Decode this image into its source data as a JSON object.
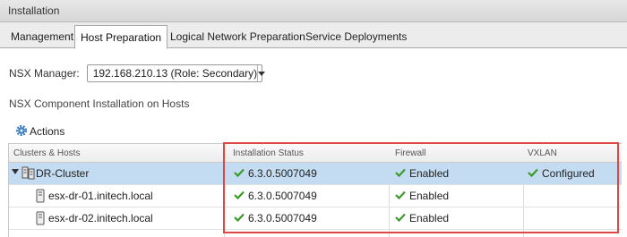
{
  "window": {
    "title": "Installation"
  },
  "tabs": [
    {
      "label": "Management"
    },
    {
      "label": "Host Preparation",
      "active": true
    },
    {
      "label": "Logical Network Preparation"
    },
    {
      "label": "Service Deployments"
    }
  ],
  "nsx_manager": {
    "label": "NSX Manager:",
    "selected": "192.168.210.13 (Role: Secondary)"
  },
  "section": {
    "title": "NSX Component Installation on Hosts"
  },
  "toolbar": {
    "actions_label": "Actions",
    "actions_icon": "gear-icon"
  },
  "table": {
    "columns": [
      "Clusters & Hosts",
      "Installation Status",
      "Firewall",
      "VXLAN"
    ],
    "rows": [
      {
        "name": "DR-Cluster",
        "kind": "cluster",
        "expanded": true,
        "install": "6.3.0.5007049",
        "firewall": "Enabled",
        "vxlan": "Configured",
        "selected": true
      },
      {
        "name": "esx-dr-01.initech.local",
        "kind": "host",
        "install": "6.3.0.5007049",
        "firewall": "Enabled",
        "vxlan": ""
      },
      {
        "name": "esx-dr-02.initech.local",
        "kind": "host",
        "install": "6.3.0.5007049",
        "firewall": "Enabled",
        "vxlan": ""
      }
    ]
  },
  "colors": {
    "accent_check": "#3a9a2a",
    "selection": "#c4dcf1",
    "highlight_border": "#e04646"
  }
}
